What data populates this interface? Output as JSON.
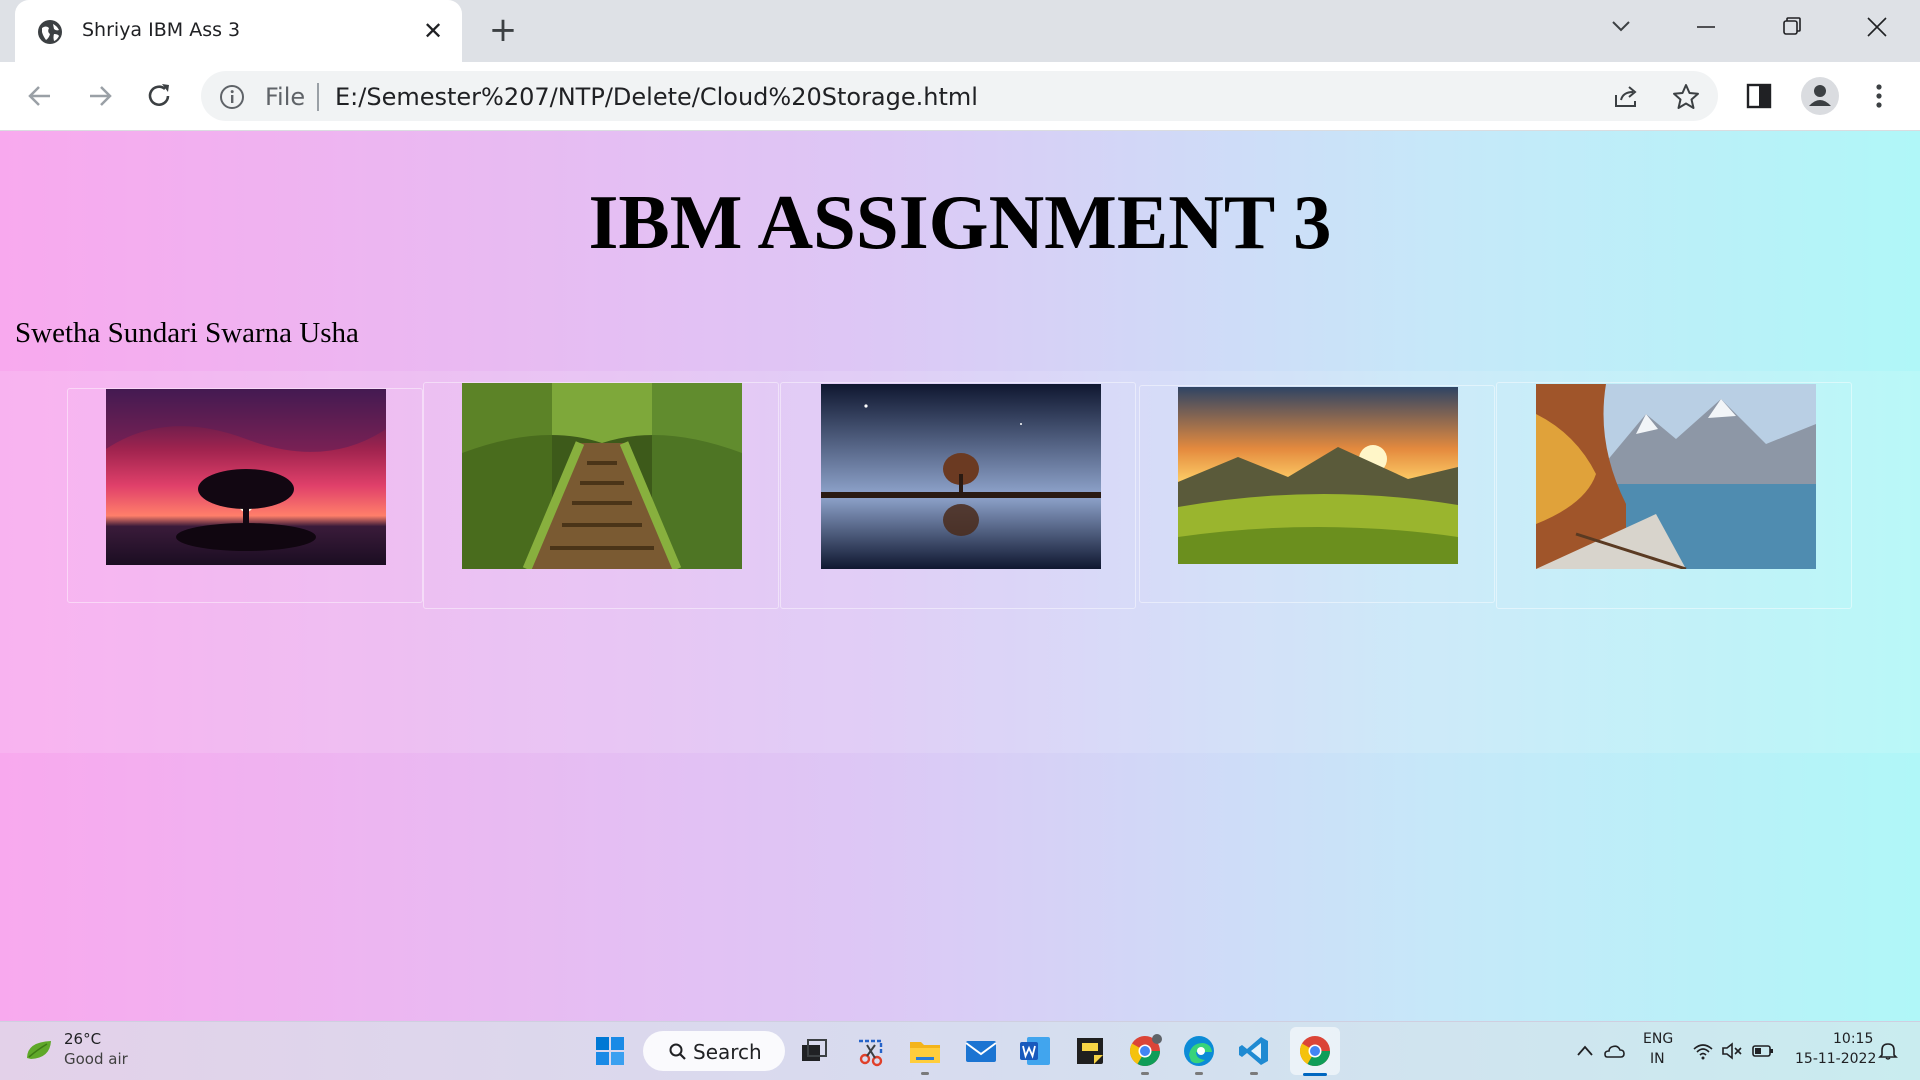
{
  "browser": {
    "tab": {
      "title": "Shriya IBM Ass 3",
      "close_glyph": "✕",
      "favicon": "globe-icon"
    },
    "new_tab_glyph": "+",
    "omnibox": {
      "scheme_label": "File",
      "url": "E:/Semester%207/NTP/Delete/Cloud%20Storage.html"
    }
  },
  "page": {
    "title": "IBM ASSIGNMENT 3",
    "author": "Swetha Sundari Swarna Usha",
    "gallery": [
      {
        "subject": "tree-sunset"
      },
      {
        "subject": "forest-boardwalk"
      },
      {
        "subject": "night-tree-reflection"
      },
      {
        "subject": "mountain-sunrise"
      },
      {
        "subject": "alpine-lake"
      }
    ]
  },
  "taskbar": {
    "weather": {
      "temp": "26°C",
      "desc": "Good air"
    },
    "search_label": "Search",
    "lang": {
      "line1": "ENG",
      "line2": "IN"
    },
    "clock": {
      "time": "10:15",
      "date": "15-11-2022"
    }
  },
  "colors": {
    "gradient_left": "#f8a9ee",
    "gradient_right": "#b0f7f8",
    "tab_strip": "#dee1e6",
    "windows_blue": "#0067c0"
  }
}
